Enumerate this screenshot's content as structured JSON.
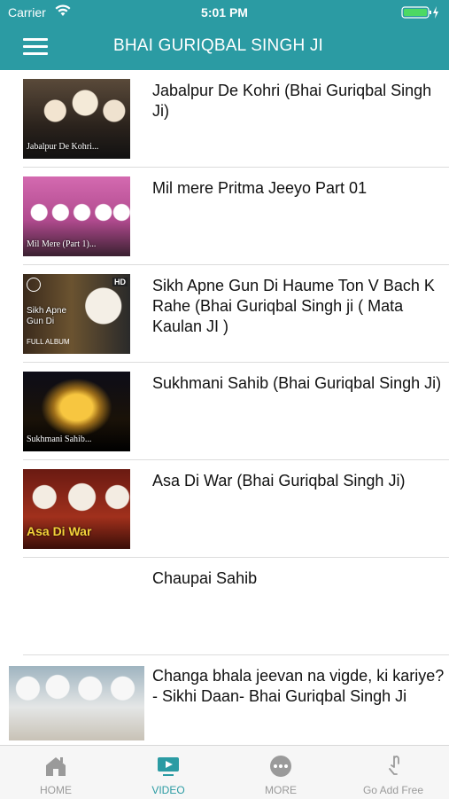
{
  "status_bar": {
    "carrier": "Carrier",
    "time": "5:01 PM"
  },
  "nav": {
    "title": "BHAI GURIQBAL SINGH JI"
  },
  "videos": [
    {
      "title": "Jabalpur De Kohri (Bhai Guriqbal Singh Ji)",
      "thumb_caption": "Jabalpur De Kohri..."
    },
    {
      "title": "Mil mere Pritma Jeeyo Part 01",
      "thumb_caption": "Mil Mere (Part 1)..."
    },
    {
      "title": "Sikh Apne Gun Di Haume Ton V Bach K Rahe (Bhai Guriqbal Singh ji ( Mata Kaulan JI )",
      "thumb_caption": "Sikh Apne Gun Di",
      "thumb_badge": "HD",
      "thumb_sub": "FULL ALBUM"
    },
    {
      "title": "Sukhmani Sahib (Bhai Guriqbal Singh Ji)",
      "thumb_caption": "Sukhmani Sahib..."
    },
    {
      "title": "Asa Di War (Bhai Guriqbal Singh Ji)",
      "thumb_caption": "Asa Di War"
    },
    {
      "title": "Chaupai Sahib"
    },
    {
      "title": "Changa bhala jeevan na vigde, ki kariye? - Sikhi Daan- Bhai Guriqbal Singh Ji"
    }
  ],
  "tabs": [
    {
      "label": "HOME",
      "icon": "home-icon",
      "active": false
    },
    {
      "label": "VIDEO",
      "icon": "video-icon",
      "active": true
    },
    {
      "label": "MORE",
      "icon": "more-icon",
      "active": false
    },
    {
      "label": "Go Add Free",
      "icon": "hand-icon",
      "active": false
    }
  ],
  "colors": {
    "accent": "#2b9ba3",
    "inactive": "#9a9a9a"
  }
}
